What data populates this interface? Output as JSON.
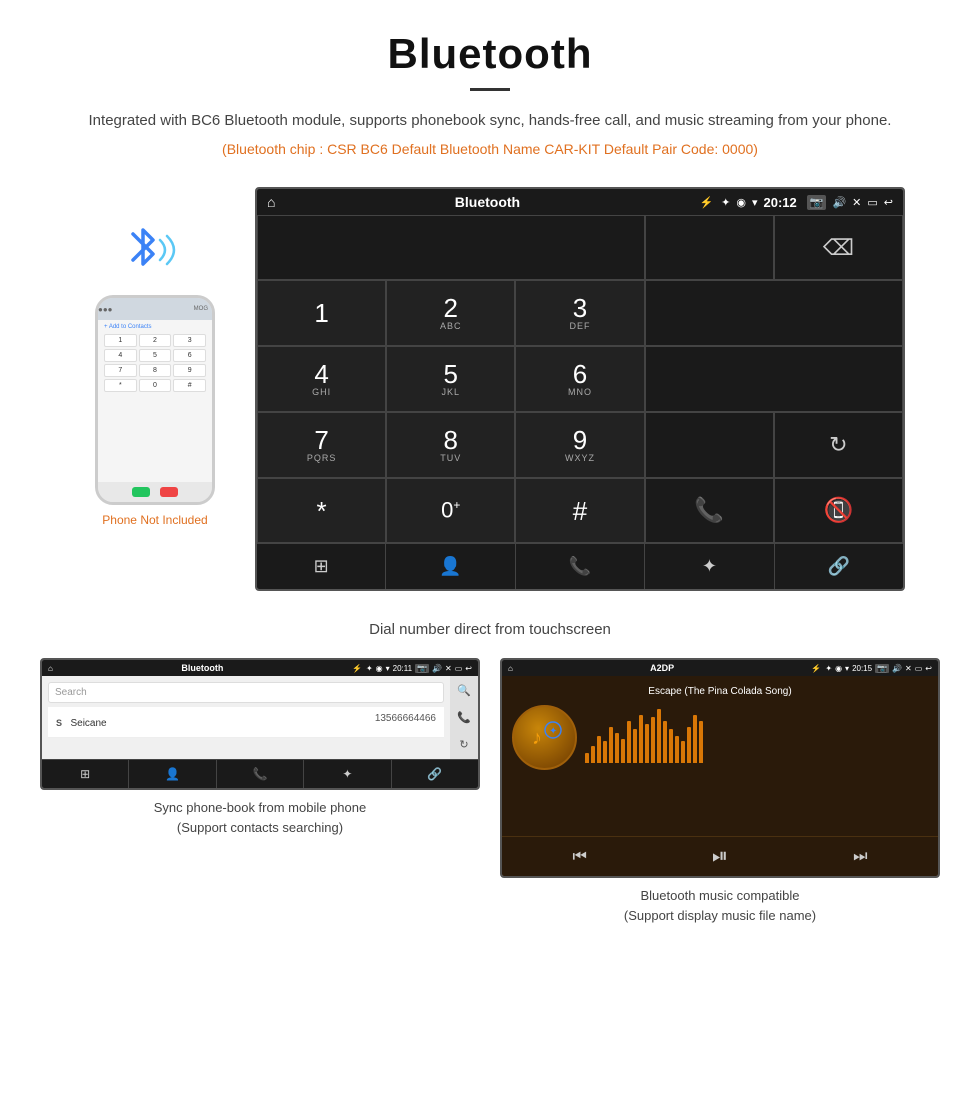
{
  "header": {
    "title": "Bluetooth",
    "description": "Integrated with BC6 Bluetooth module, supports phonebook sync, hands-free call, and music streaming from your phone.",
    "specs": "(Bluetooth chip : CSR BC6    Default Bluetooth Name CAR-KIT    Default Pair Code: 0000)"
  },
  "dialpad": {
    "caption": "Dial number direct from touchscreen",
    "status_title": "Bluetooth",
    "time": "20:12",
    "keys": [
      {
        "num": "1",
        "sub": ""
      },
      {
        "num": "2",
        "sub": "ABC"
      },
      {
        "num": "3",
        "sub": "DEF"
      },
      {
        "num": "4",
        "sub": "GHI"
      },
      {
        "num": "5",
        "sub": "JKL"
      },
      {
        "num": "6",
        "sub": "MNO"
      },
      {
        "num": "7",
        "sub": "PQRS"
      },
      {
        "num": "8",
        "sub": "TUV"
      },
      {
        "num": "9",
        "sub": "WXYZ"
      },
      {
        "num": "*",
        "sub": ""
      },
      {
        "num": "0+",
        "sub": ""
      },
      {
        "num": "#",
        "sub": ""
      }
    ],
    "nav_items": [
      "grid",
      "person",
      "phone",
      "bluetooth",
      "link"
    ]
  },
  "phonebook": {
    "caption_line1": "Sync phone-book from mobile phone",
    "caption_line2": "(Support contacts searching)",
    "status_title": "Bluetooth",
    "time": "20:11",
    "search_placeholder": "Search",
    "contact_letter": "S",
    "contact_name": "Seicane",
    "contact_number": "13566664466"
  },
  "music": {
    "caption_line1": "Bluetooth music compatible",
    "caption_line2": "(Support display music file name)",
    "status_title": "A2DP",
    "time": "20:15",
    "song_title": "Escape (The Pina Colada Song)",
    "visualizer_bars": [
      8,
      14,
      22,
      18,
      30,
      25,
      20,
      35,
      28,
      40,
      32,
      38,
      45,
      35,
      28,
      22,
      18,
      30,
      40,
      35
    ]
  },
  "phone_mockup": {
    "not_included": "Phone Not Included",
    "add_contact": "+ Add to Contacts",
    "keys": [
      "1",
      "2",
      "3",
      "4",
      "5",
      "6",
      "7",
      "8",
      "9",
      "*",
      "0",
      "#"
    ]
  }
}
